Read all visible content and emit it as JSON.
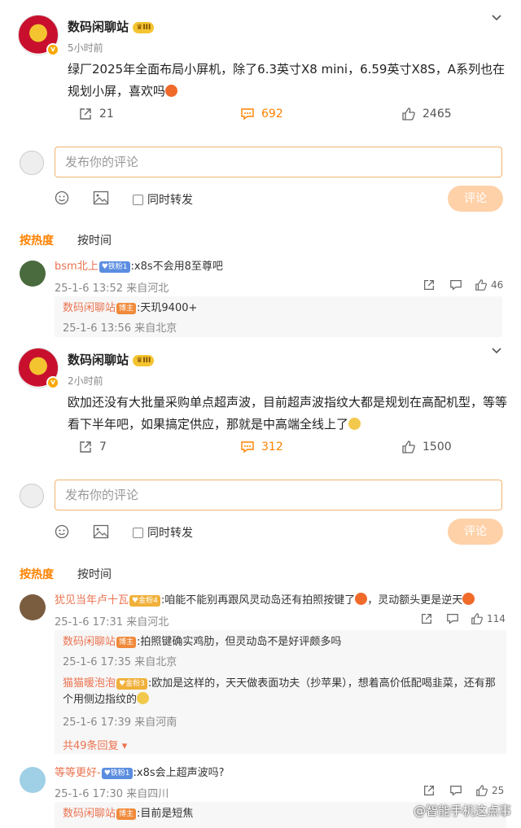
{
  "post1": {
    "author": "数码闲聊站",
    "rank": "III",
    "time": "5小时前",
    "text": "绿厂2025年全面布局小屏机，除了6.3英寸X8 mini，6.59英寸X8S，A系列也在规划小屏，喜欢吗",
    "shares": "21",
    "comments": "692",
    "likes": "2465"
  },
  "composer1": {
    "placeholder": "发布你的评论",
    "repost_label": "同时转发",
    "submit_label": "评论"
  },
  "sort1": {
    "hot": "按热度",
    "time": "按时间"
  },
  "comment1": {
    "name": "bsm北上",
    "tag": "铁粉1",
    "text": ":x8s不会用8至尊吧",
    "meta": "25-1-6 13:52 来自河北",
    "likes": "46",
    "reply": {
      "name": "数码闲聊站",
      "tag": "博主",
      "text": ":天玑9400+",
      "meta": "25-1-6 13:56 来自北京"
    }
  },
  "post2": {
    "author": "数码闲聊站",
    "rank": "III",
    "time": "2小时前",
    "text": "欧加还没有大批量采购单点超声波，目前超声波指纹大都是规划在高配机型，等等看下半年吧，如果搞定供应，那就是中高端全线上了",
    "shares": "7",
    "comments": "312",
    "likes": "1500"
  },
  "composer2": {
    "placeholder": "发布你的评论",
    "repost_label": "同时转发",
    "submit_label": "评论"
  },
  "sort2": {
    "hot": "按热度",
    "time": "按时间"
  },
  "comment2": {
    "name": "犹见当年卢十瓦",
    "tag": "金粉4",
    "text_a": ":咱能不能别再跟风灵动岛还有拍照按键了",
    "text_b": "，灵动额头更是逆天",
    "meta": "25-1-6 17:31 来自河北",
    "likes": "114",
    "replies": [
      {
        "name": "数码闲聊站",
        "tag": "博主",
        "text": ":拍照键确实鸡肋，但灵动岛不是好评颇多吗",
        "meta": "25-1-6 17:35 来自北京"
      },
      {
        "name": "猫猫暖泡泡",
        "tag": "金粉3",
        "text": ":欧加是这样的，天天做表面功夫（抄苹果），想着高价低配喝韭菜，还有那个用侧边指纹的",
        "meta": "25-1-6 17:39 来自河南"
      }
    ],
    "more": "共49条回复"
  },
  "comment3": {
    "name": "等等更好-",
    "tag": "铁粉1",
    "text": ":x8s会上超声波吗?",
    "meta": "25-1-6 17:30 来自四川",
    "likes": "25",
    "reply": {
      "name": "数码闲聊站",
      "tag": "博主",
      "text": ":目前是短焦"
    }
  },
  "watermark": "@智能手机这点事",
  "colors": {
    "accent": "#ff8200",
    "name": "#eb7350",
    "border": "#f2b36c"
  }
}
